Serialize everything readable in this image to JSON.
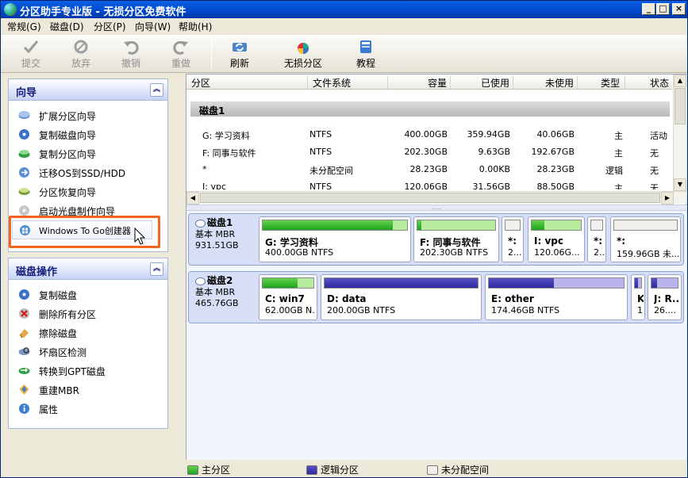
{
  "window": {
    "title": "分区助手专业版 - 无损分区免费软件"
  },
  "menu": [
    "常规(G)",
    "磁盘(D)",
    "分区(P)",
    "向导(W)",
    "帮助(H)"
  ],
  "toolbar": {
    "commit": "提交",
    "discard": "放弃",
    "undo": "撤销",
    "redo": "重做",
    "refresh": "刷新",
    "lossless": "无损分区",
    "tutorial": "教程"
  },
  "wizard": {
    "title": "向导",
    "items": [
      "扩展分区向导",
      "复制磁盘向导",
      "复制分区向导",
      "迁移OS到SSD/HDD",
      "分区恢复向导",
      "启动光盘制作向导",
      "Windows To Go创建器"
    ]
  },
  "diskops": {
    "title": "磁盘操作",
    "items": [
      "复制磁盘",
      "删除所有分区",
      "擦除磁盘",
      "坏扇区检测",
      "转换到GPT磁盘",
      "重建MBR",
      "属性"
    ]
  },
  "table": {
    "headers": [
      "分区",
      "文件系统",
      "容量",
      "已使用",
      "未使用",
      "类型",
      "状态"
    ],
    "disk_label": "磁盘1",
    "rows": [
      {
        "name": "G: 学习资料",
        "fs": "NTFS",
        "cap": "400.00GB",
        "used": "359.94GB",
        "free": "40.06GB",
        "type": "主",
        "status": "活动"
      },
      {
        "name": "F: 同事与软件",
        "fs": "NTFS",
        "cap": "202.30GB",
        "used": "9.63GB",
        "free": "192.67GB",
        "type": "主",
        "status": "无"
      },
      {
        "name": "*",
        "fs": "未分配空间",
        "cap": "28.23GB",
        "used": "0.00KB",
        "free": "28.23GB",
        "type": "逻辑",
        "status": "无"
      },
      {
        "name": "I: vpc",
        "fs": "NTFS",
        "cap": "120.06GB",
        "used": "31.56GB",
        "free": "88.50GB",
        "type": "主",
        "status": "无"
      }
    ]
  },
  "disks": [
    {
      "name": "磁盘1",
      "kind": "基本 MBR",
      "size": "931.51GB",
      "parts": [
        {
          "name": "G: 学习资料",
          "size": "400.00GB NTFS",
          "kind": "pri",
          "used": 0.9
        },
        {
          "name": "F: 同事与软件",
          "size": "202.30GB NTFS",
          "kind": "pri",
          "used": 0.05
        },
        {
          "name": "*:",
          "size": "2...",
          "kind": "una",
          "used": 0
        },
        {
          "name": "I: vpc",
          "size": "120.06G...",
          "kind": "pri",
          "used": 0.26
        },
        {
          "name": "*:",
          "size": "2...",
          "kind": "una",
          "used": 0
        },
        {
          "name": "*:",
          "size": "159.96GB 未...",
          "kind": "una",
          "used": 0
        }
      ]
    },
    {
      "name": "磁盘2",
      "kind": "基本 MBR",
      "size": "465.76GB",
      "parts": [
        {
          "name": "C: win7",
          "size": "62.00GB N...",
          "kind": "pri",
          "used": 0.68
        },
        {
          "name": "D: data",
          "size": "200.00GB NTFS",
          "kind": "log",
          "used": 1.0
        },
        {
          "name": "E: other",
          "size": "174.46GB NTFS",
          "kind": "log",
          "used": 0.48
        },
        {
          "name": "K",
          "size": "1",
          "kind": "log",
          "used": 0.5
        },
        {
          "name": "J: R...",
          "size": "26....",
          "kind": "log",
          "used": 0.22
        }
      ]
    }
  ],
  "legend": {
    "primary": "主分区",
    "logical": "逻辑分区",
    "unallocated": "未分配空间"
  },
  "colors": {
    "highlight": "#f26522",
    "primary": "#2faa2f",
    "logical": "#3a36a8",
    "title": "#0a5ee6"
  }
}
